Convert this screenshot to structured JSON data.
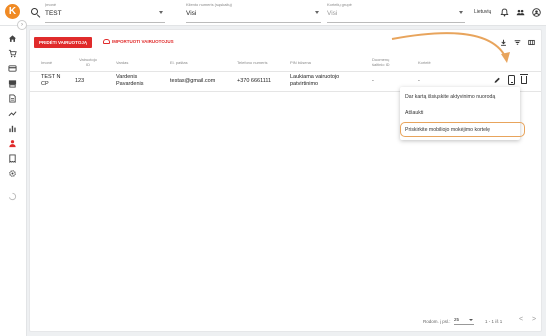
{
  "app": {
    "logo_letter": "K"
  },
  "header": {
    "search_icon": "search-icon",
    "store": {
      "label": "Įmonė",
      "value": "TEST"
    },
    "client_number": {
      "label": "Kliento numeris (sąskaitų)",
      "value": "Visi"
    },
    "card_group": {
      "label": "Kortelių grupė",
      "placeholder": "Visi"
    },
    "language": "Lietuvių",
    "icons": [
      "bell-icon",
      "users-icon",
      "account-circle-icon"
    ]
  },
  "sidebar": {
    "items": [
      "home-icon",
      "cart-icon",
      "card-icon",
      "pos-icon",
      "document-icon",
      "trending-icon",
      "bar-chart-icon",
      "driver-icon",
      "receipt-icon",
      "settings-icon",
      "loading-icon"
    ]
  },
  "toolbar": {
    "add_label": "PRIDĖTI VAIRUOTOJĄ",
    "import_label": "IMPORTUOTI VAIRUOTOJUS",
    "icons": [
      "download-icon",
      "filter-icon",
      "columns-icon"
    ]
  },
  "table": {
    "columns": [
      "Imonė",
      "Vairuotojo ID",
      "Vardas",
      "El. paštas",
      "Telefono numeris",
      "PIN būsena",
      "Duomenų šaltinio ID",
      "Kortelė"
    ],
    "rows": [
      {
        "company": "TEST N CP",
        "driver_id": "123",
        "name": "Vardenis Pavardenis",
        "email": "testas@gmail.com",
        "phone": "+370 6661111",
        "pin_status": "Laukiama vairuotojo patvirtinimo",
        "source_id": "-",
        "card": "-"
      }
    ]
  },
  "context_menu": {
    "items": [
      "Dar kartą išsiųskite aktyvinimo nuorodą",
      "Atšaukti",
      "Priskirkite mobiliojo mokėjimo kortelę"
    ],
    "highlighted_index": 2
  },
  "footer": {
    "rows_per_page_label": "Rodom. į psl.:",
    "rows_per_page_value": "25",
    "range": "1 - 1 iš 1",
    "prev": "<",
    "next": ">"
  },
  "colors": {
    "accent": "#e02b2b",
    "logo": "#f08a24",
    "highlight": "#e8a45c"
  }
}
